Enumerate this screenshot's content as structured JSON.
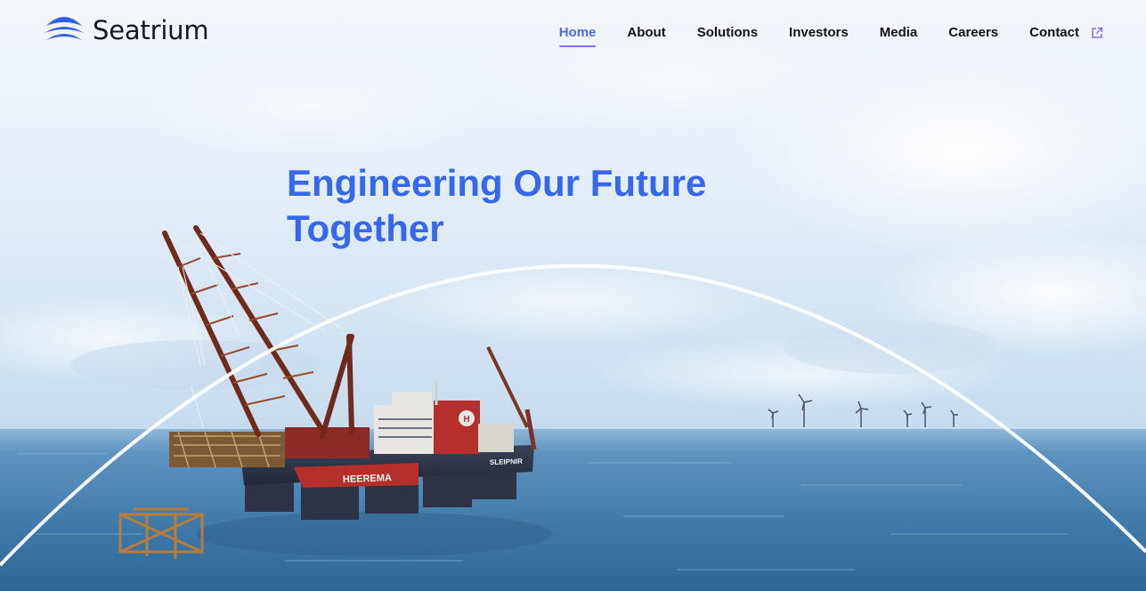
{
  "brand": {
    "name": "Seatrium",
    "color": "#2f5fe9"
  },
  "nav": {
    "items": [
      {
        "label": "Home",
        "active": true
      },
      {
        "label": "About",
        "active": false
      },
      {
        "label": "Solutions",
        "active": false
      },
      {
        "label": "Investors",
        "active": false
      },
      {
        "label": "Media",
        "active": false
      },
      {
        "label": "Careers",
        "active": false
      },
      {
        "label": "Contact",
        "active": false
      }
    ],
    "external_icon": "external-link-icon",
    "active_color": "#4a6cf0",
    "underline_color": "#8a6df0"
  },
  "hero": {
    "title": "Engineering Our Future Together",
    "title_color": "#3568ee",
    "vessel_texts": [
      "HEEREMA",
      "SLEIPNIR",
      "H"
    ]
  },
  "colors": {
    "sky": "#dfeaf6",
    "sea": "#3d79a8",
    "text": "#111111"
  }
}
